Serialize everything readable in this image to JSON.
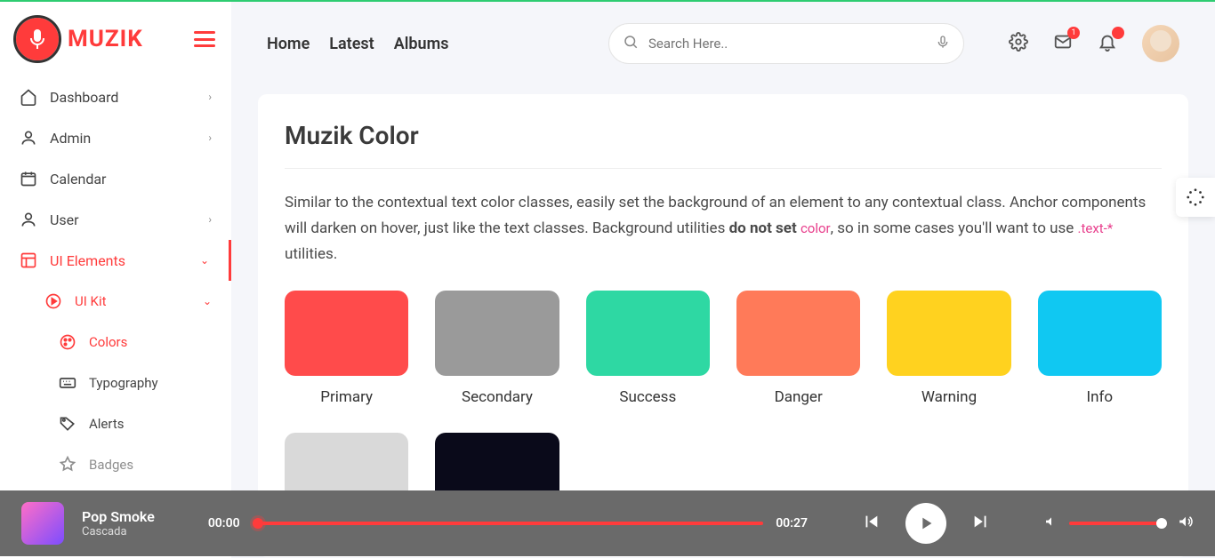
{
  "brand": "MUZIK",
  "topnav": {
    "home": "Home",
    "latest": "Latest",
    "albums": "Albums"
  },
  "search": {
    "placeholder": "Search Here.."
  },
  "badges": {
    "mail": "1",
    "bell": ""
  },
  "sidebar": {
    "items": [
      {
        "label": "Dashboard"
      },
      {
        "label": "Admin"
      },
      {
        "label": "Calendar"
      },
      {
        "label": "User"
      },
      {
        "label": "UI Elements"
      }
    ],
    "uikit": {
      "label": "UI Kit"
    },
    "uikit_children": [
      {
        "label": "Colors"
      },
      {
        "label": "Typography"
      },
      {
        "label": "Alerts"
      },
      {
        "label": "Badges"
      }
    ]
  },
  "page": {
    "title": "Muzik Color",
    "desc_1": "Similar to the contextual text color classes, easily set the background of an element to any contextual class. Anchor components will darken on hover, just like the text classes. Background utilities ",
    "desc_bold": "do not set ",
    "desc_code1": "color",
    "desc_2": ", so in some cases you'll want to use ",
    "desc_code2": ".text-*",
    "desc_3": " utilities."
  },
  "swatches": [
    {
      "label": "Primary",
      "color": "#ff4b4b"
    },
    {
      "label": "Secondary",
      "color": "#9a9a9a"
    },
    {
      "label": "Success",
      "color": "#2ed8a3"
    },
    {
      "label": "Danger",
      "color": "#ff7a59"
    },
    {
      "label": "Warning",
      "color": "#ffd21f"
    },
    {
      "label": "Info",
      "color": "#10c8f2"
    },
    {
      "label": "",
      "color": "#d9d9d9"
    },
    {
      "label": "",
      "color": "#0a0a1a"
    }
  ],
  "player": {
    "title": "Pop Smoke",
    "artist": "Cascada",
    "elapsed": "00:00",
    "duration": "00:27"
  }
}
